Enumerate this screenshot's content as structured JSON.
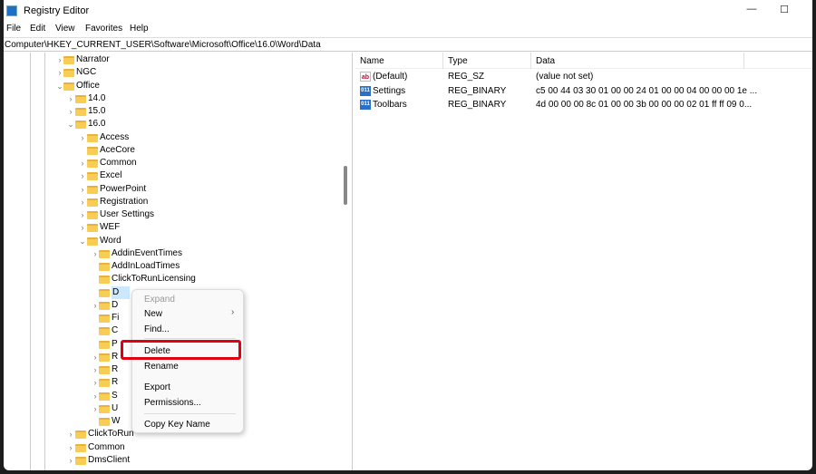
{
  "window": {
    "title": "Registry Editor",
    "minimize": "—",
    "maximize": "☐"
  },
  "menu": [
    "File",
    "Edit",
    "View",
    "Favorites",
    "Help"
  ],
  "address": "Computer\\HKEY_CURRENT_USER\\Software\\Microsoft\\Office\\16.0\\Word\\Data",
  "tree": [
    {
      "label": "Narrator",
      "level": 0,
      "chev": "›"
    },
    {
      "label": "NGC",
      "level": 0,
      "chev": "›"
    },
    {
      "label": "Office",
      "level": 0,
      "chev": "⌄"
    },
    {
      "label": "14.0",
      "level": 1,
      "chev": "›"
    },
    {
      "label": "15.0",
      "level": 1,
      "chev": "›"
    },
    {
      "label": "16.0",
      "level": 1,
      "chev": "⌄"
    },
    {
      "label": "Access",
      "level": 2,
      "chev": "›"
    },
    {
      "label": "AceCore",
      "level": 2,
      "chev": ""
    },
    {
      "label": "Common",
      "level": 2,
      "chev": "›"
    },
    {
      "label": "Excel",
      "level": 2,
      "chev": "›"
    },
    {
      "label": "PowerPoint",
      "level": 2,
      "chev": "›"
    },
    {
      "label": "Registration",
      "level": 2,
      "chev": "›"
    },
    {
      "label": "User Settings",
      "level": 2,
      "chev": "›"
    },
    {
      "label": "WEF",
      "level": 2,
      "chev": "›"
    },
    {
      "label": "Word",
      "level": 2,
      "chev": "⌄"
    },
    {
      "label": "AddinEventTimes",
      "level": 3,
      "chev": "›"
    },
    {
      "label": "AddInLoadTimes",
      "level": 3,
      "chev": ""
    },
    {
      "label": "ClickToRunLicensing",
      "level": 3,
      "chev": ""
    },
    {
      "label": "D",
      "level": 3,
      "chev": "",
      "selected": true
    },
    {
      "label": "D",
      "level": 3,
      "chev": "›"
    },
    {
      "label": "Fi",
      "level": 3,
      "chev": ""
    },
    {
      "label": "C",
      "level": 3,
      "chev": ""
    },
    {
      "label": "P",
      "level": 3,
      "chev": ""
    },
    {
      "label": "R",
      "level": 3,
      "chev": "›"
    },
    {
      "label": "R",
      "level": 3,
      "chev": "›"
    },
    {
      "label": "R",
      "level": 3,
      "chev": "›"
    },
    {
      "label": "S",
      "level": 3,
      "chev": "›"
    },
    {
      "label": "U",
      "level": 3,
      "chev": "›"
    },
    {
      "label": "W",
      "level": 3,
      "chev": ""
    },
    {
      "label": "ClickToRun",
      "level": 1,
      "chev": "›"
    },
    {
      "label": "Common",
      "level": 1,
      "chev": "›"
    },
    {
      "label": "DmsClient",
      "level": 1,
      "chev": "›"
    }
  ],
  "values": {
    "headers": [
      "Name",
      "Type",
      "Data"
    ],
    "rows": [
      {
        "name": "(Default)",
        "type": "REG_SZ",
        "data": "(value not set)",
        "icon": "ab"
      },
      {
        "name": "Settings",
        "type": "REG_BINARY",
        "data": "c5 00 44 03 30 01 00 00 24 01 00 00 04 00 00 00 1e ...",
        "icon": "011"
      },
      {
        "name": "Toolbars",
        "type": "REG_BINARY",
        "data": "4d 00 00 00 8c 01 00 00 3b 00 00 00 02 01 ff ff 09 0...",
        "icon": "011"
      }
    ]
  },
  "context_menu": {
    "expand": "Expand",
    "new": "New",
    "new_arrow": "›",
    "find": "Find...",
    "delete": "Delete",
    "rename": "Rename",
    "export": "Export",
    "permissions": "Permissions...",
    "copy_key_name": "Copy Key Name"
  },
  "colors": {
    "highlight": "#e00010",
    "folder": "#f8cd55"
  }
}
